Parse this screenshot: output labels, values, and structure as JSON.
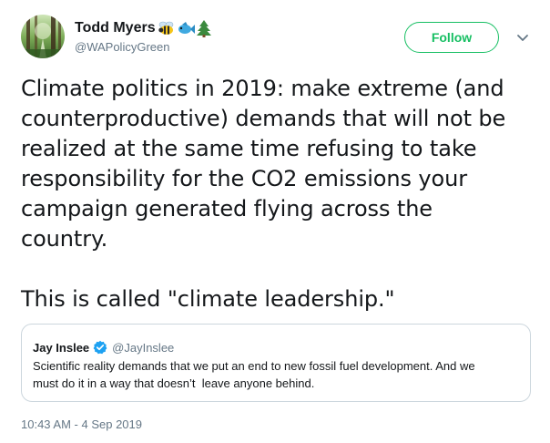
{
  "author": {
    "display_name": "Todd Myers",
    "handle": "@WAPolicyGreen",
    "name_emojis": [
      "bee-emoji-icon",
      "fish-emoji-icon",
      "evergreen-tree-emoji-icon"
    ]
  },
  "follow_button": {
    "label": "Follow",
    "color": "#17bf63"
  },
  "tweet": {
    "paragraphs": [
      "Climate politics in 2019: make extreme (and\ncounterproductive) demands that will not be\nrealized at the same time refusing to take\nresponsibility for the CO2 emissions your\ncampaign generated flying across the\ncountry.",
      "This is called \"climate leadership.\""
    ]
  },
  "quoted_tweet": {
    "display_name": "Jay Inslee",
    "verified": true,
    "handle": "@JayInslee",
    "text": "Scientific reality demands that we put an end to new fossil fuel development. And we\nmust do it in a way that doesn’t  leave anyone behind."
  },
  "timestamp": "10:43 AM - 4 Sep 2019",
  "colors": {
    "text_primary": "#14171a",
    "text_secondary": "#657786",
    "border": "#ccd6dd",
    "verified_blue": "#1da1f2",
    "follow_green": "#17bf63"
  }
}
